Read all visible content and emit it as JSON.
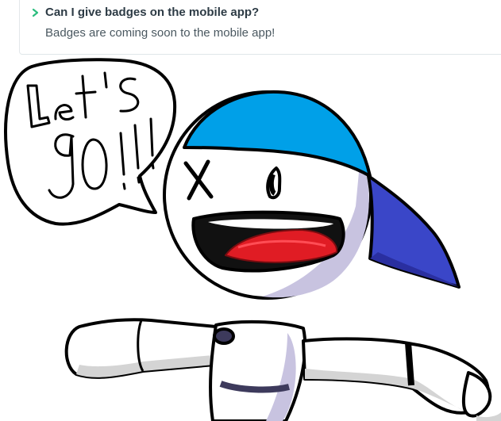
{
  "faq": {
    "question": "Can I give badges on the mobile app?",
    "answer": "Badges are coming soon to the mobile app!",
    "chevron_icon": "chevron-right-icon",
    "accent_color": "#2bbd7e"
  },
  "drawing": {
    "speech_text": "Let's go!!!",
    "colors": {
      "cap": "#00a0e8",
      "cap_brim": "#3a46c8",
      "mouth": "#111111",
      "tongue": "#e01c24",
      "shade": "#c8c3e0"
    }
  }
}
